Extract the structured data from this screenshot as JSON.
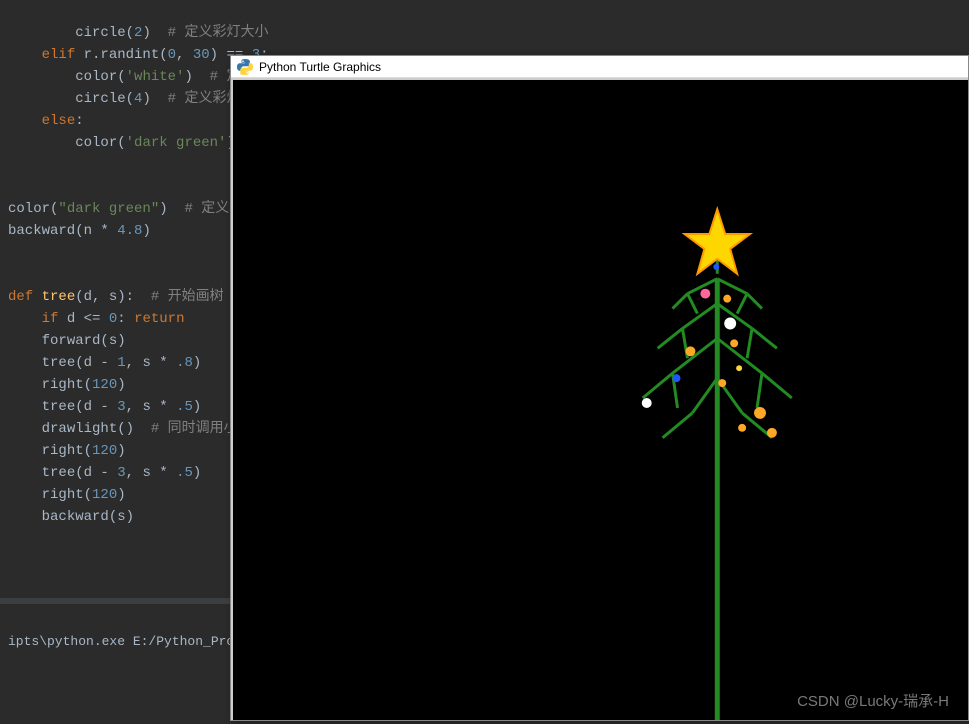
{
  "code": {
    "l1": "circle",
    "l1a": "(",
    "l1n": "2",
    "l1b": ")",
    "l1c": "  # 定义彩灯大小",
    "l2": "elif",
    "l2a": " r.randint(",
    "l2n1": "0",
    "l2c": ", ",
    "l2n2": "30",
    "l2b": ") == ",
    "l2n3": "3",
    "l2d": ":",
    "l3": "color",
    "l3a": "(",
    "l3s": "'white'",
    "l3b": ")",
    "l3c": "  # 定义第四种颜色",
    "l4": "circle",
    "l4a": "(",
    "l4n": "4",
    "l4b": ")",
    "l4c": "  # 定义彩灯大",
    "l5": "else",
    "l5a": ":",
    "l6": "color",
    "l6a": "(",
    "l6s": "'dark green'",
    "l6b": ")",
    "l7": "color",
    "l7a": "(",
    "l7s": "\"dark green\"",
    "l7b": ")",
    "l7c": "  # 定义树枝",
    "l8": "backward",
    "l8a": "(n * ",
    "l8n": "4.8",
    "l8b": ")",
    "l9": "def",
    "l9a": " ",
    "l9f": "tree",
    "l9b": "(d, s):",
    "l9c": "  # 开始画树",
    "l10": "if",
    "l10a": " d <= ",
    "l10n": "0",
    "l10b": ": ",
    "l10r": "return",
    "l11": "forward(s)",
    "l12": "tree(d - ",
    "l12n": "1",
    "l12a": ", s * ",
    "l12n2": ".8",
    "l12b": ")",
    "l13": "right(",
    "l13n": "120",
    "l13a": ")",
    "l14": "tree(d - ",
    "l14n": "3",
    "l14a": ", s * ",
    "l14n2": ".5",
    "l14b": ")",
    "l15": "drawlight()",
    "l15c": "  # 同时调用小彩",
    "l16": "right(",
    "l16n": "120",
    "l16a": ")",
    "l17": "tree(d - ",
    "l17n": "3",
    "l17a": ", s * ",
    "l17n2": ".5",
    "l17b": ")",
    "l18": "right(",
    "l18n": "120",
    "l18a": ")",
    "l19": "backward(s)"
  },
  "terminal": {
    "line": "ipts\\python.exe E:/Python_Proj"
  },
  "window": {
    "title": "Python Turtle Graphics"
  },
  "watermark": "CSDN @Lucky-瑞承-H"
}
